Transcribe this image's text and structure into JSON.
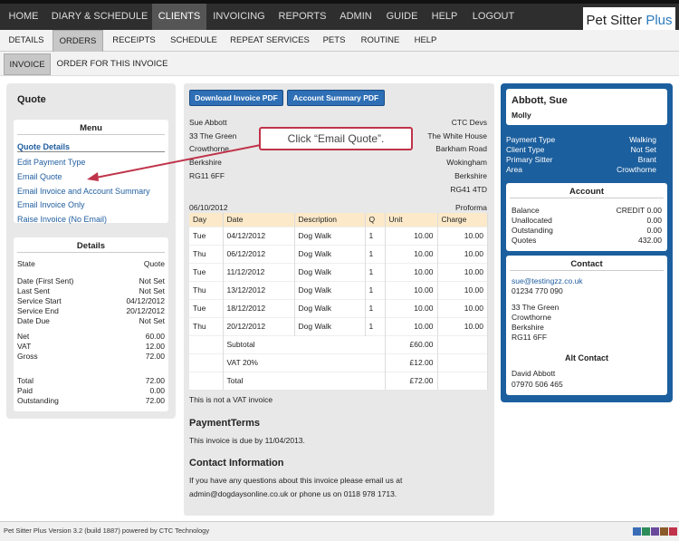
{
  "topnav": [
    "HOME",
    "DIARY & SCHEDULE",
    "CLIENTS",
    "INVOICING",
    "REPORTS",
    "ADMIN",
    "GUIDE",
    "HELP",
    "LOGOUT"
  ],
  "brand": {
    "name": "Pet Sitter",
    "plus": "Plus"
  },
  "subnav": [
    "DETAILS",
    "ORDERS",
    "RECEIPTS",
    "SCHEDULE",
    "REPEAT SERVICES",
    "PETS",
    "ROUTINE",
    "HELP"
  ],
  "subnav2": [
    "INVOICE",
    "ORDER FOR THIS INVOICE"
  ],
  "left": {
    "title": "Quote",
    "menu_title": "Menu",
    "menu": [
      "Quote Details",
      "Edit Payment Type",
      "Email Quote",
      "Email Invoice and Account Summary",
      "Email Invoice Only",
      "Raise Invoice (No Email)"
    ],
    "details_title": "Details",
    "details": [
      [
        "State",
        "Quote"
      ],
      [
        "Date (First Sent)",
        "Not Set"
      ],
      [
        "Last Sent",
        "Not Set"
      ],
      [
        "Service Start",
        "04/12/2012"
      ],
      [
        "Service End",
        "20/12/2012"
      ],
      [
        "Date Due",
        "Not Set"
      ],
      [
        "Net",
        "60.00"
      ],
      [
        "VAT",
        "12.00"
      ],
      [
        "Gross",
        "72.00"
      ],
      [
        "Total",
        "72.00"
      ],
      [
        "Paid",
        "0.00"
      ],
      [
        "Outstanding",
        "72.00"
      ]
    ]
  },
  "center": {
    "btn1": "Download Invoice PDF",
    "btn2": "Account Summary PDF",
    "to": [
      "Sue Abbott",
      "33 The Green",
      "Crowthorne",
      "Berkshire",
      "RG11 6FF"
    ],
    "from": [
      "CTC Devs",
      "The White House",
      "Barkham Road",
      "Wokingham",
      "Berkshire",
      "RG41 4TD"
    ],
    "date": "06/10/2012",
    "proforma": "Proforma",
    "headers": [
      "Day",
      "Date",
      "Description",
      "Q",
      "Unit",
      "Charge"
    ],
    "rows": [
      [
        "Tue",
        "04/12/2012",
        "Dog Walk",
        "1",
        "10.00",
        "10.00"
      ],
      [
        "Thu",
        "06/12/2012",
        "Dog Walk",
        "1",
        "10.00",
        "10.00"
      ],
      [
        "Tue",
        "11/12/2012",
        "Dog Walk",
        "1",
        "10.00",
        "10.00"
      ],
      [
        "Thu",
        "13/12/2012",
        "Dog Walk",
        "1",
        "10.00",
        "10.00"
      ],
      [
        "Tue",
        "18/12/2012",
        "Dog Walk",
        "1",
        "10.00",
        "10.00"
      ],
      [
        "Thu",
        "20/12/2012",
        "Dog Walk",
        "1",
        "10.00",
        "10.00"
      ]
    ],
    "totals": [
      [
        "Subtotal",
        "£60.00"
      ],
      [
        "VAT 20%",
        "£12.00"
      ],
      [
        "Total",
        "£72.00"
      ]
    ],
    "vatnote": "This is not a VAT invoice",
    "pt_title": "PaymentTerms",
    "pt_text": "This invoice is due by 11/04/2013.",
    "ci_title": "Contact Information",
    "ci_line1": "If you have any questions about this invoice please email us at",
    "ci_line2": "admin@dogdaysonline.co.uk or phone us on 0118 978 1713."
  },
  "callout": "Click “Email Quote”.",
  "right": {
    "name": "Abbott, Sue",
    "pet": "Molly",
    "info": [
      [
        "Payment Type",
        "Walking"
      ],
      [
        "Client Type",
        "Not Set"
      ],
      [
        "Primary Sitter",
        "Brant"
      ],
      [
        "Area",
        "Crowthorne"
      ]
    ],
    "account_title": "Account",
    "account": [
      [
        "Balance",
        "CREDIT 0.00"
      ],
      [
        "Unallocated",
        "0.00"
      ],
      [
        "Outstanding",
        "0.00"
      ],
      [
        "Quotes",
        "432.00"
      ]
    ],
    "contact_title": "Contact",
    "email": "sue@testingzz.co.uk",
    "phone": "01234 770 090",
    "address": [
      "33 The Green",
      "Crowthorne",
      "Berkshire",
      "RG11 6FF"
    ],
    "alt_title": "Alt Contact",
    "alt_name": "David Abbott",
    "alt_phone": "07970 506 465"
  },
  "footer": "Pet Sitter Plus Version 3.2 (build 1887) powered by CTC Technology",
  "swatches": [
    "#3a6db5",
    "#2e8c5a",
    "#6a4a9c",
    "#8a5a2a",
    "#c0334a"
  ]
}
